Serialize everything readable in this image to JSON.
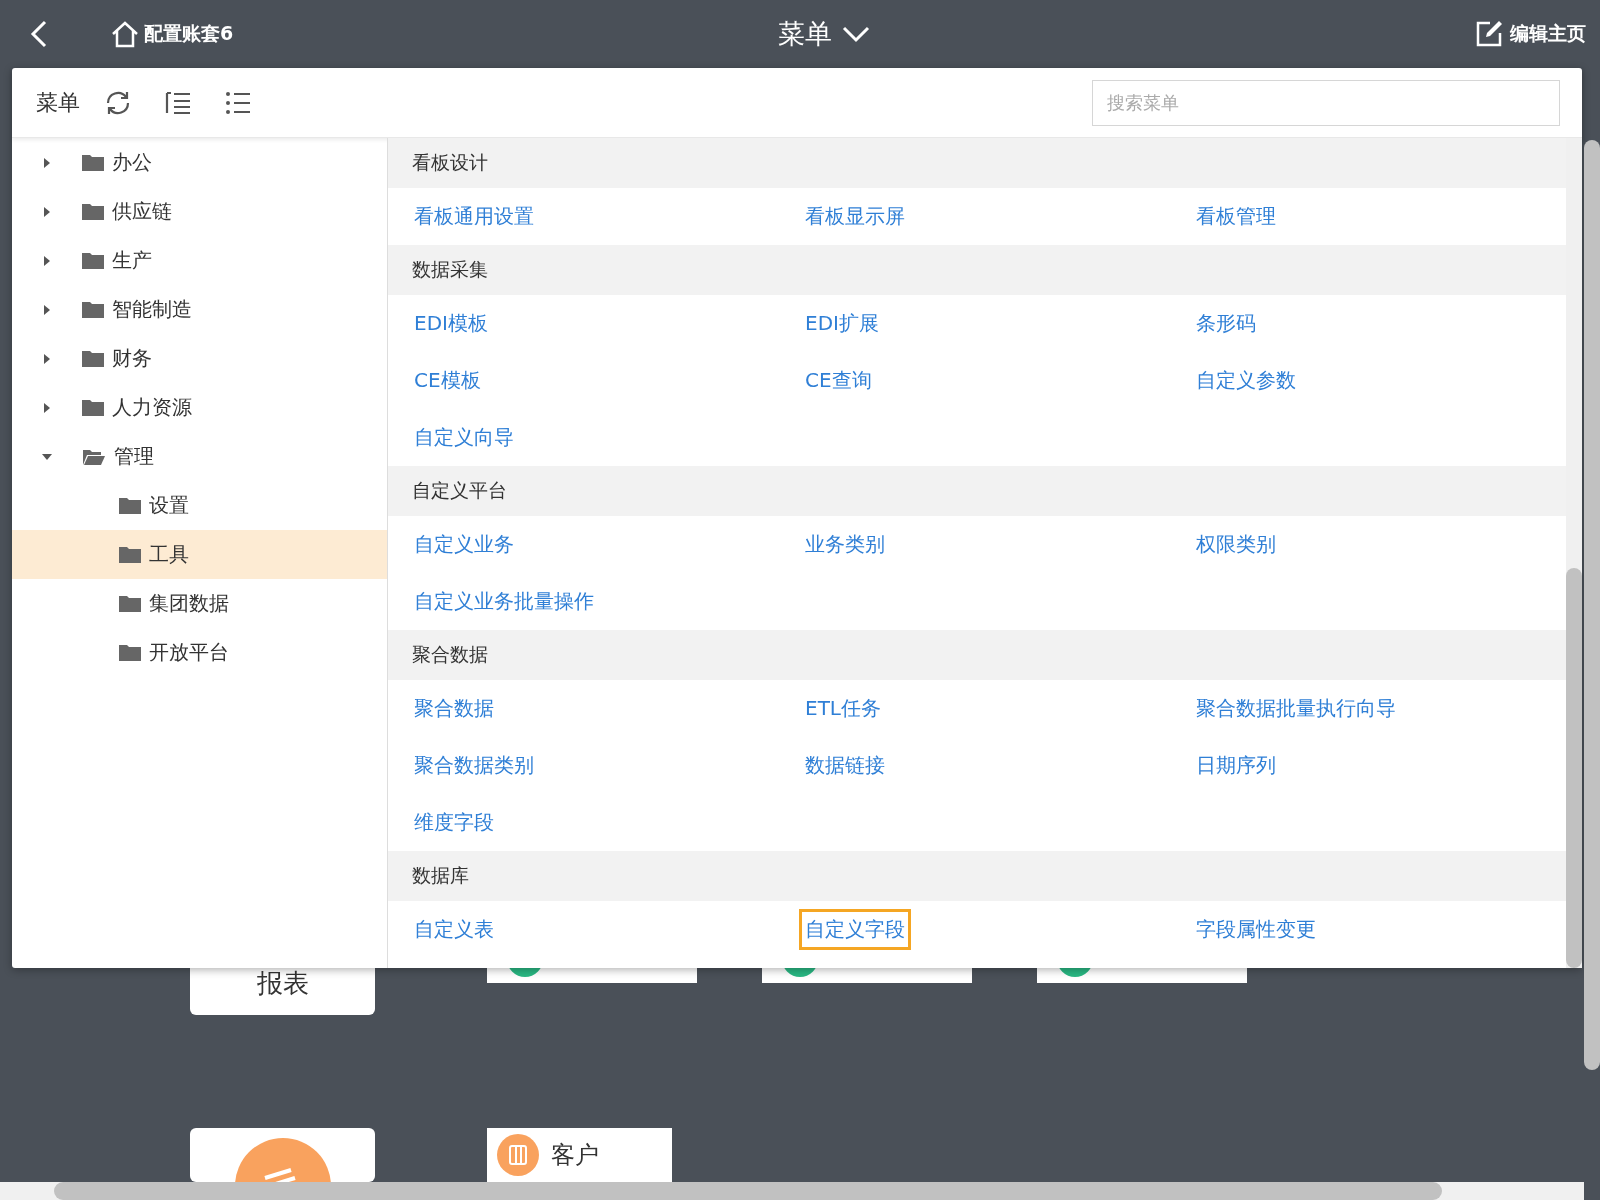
{
  "header": {
    "account": "配置账套6",
    "title": "菜单",
    "edit_label": "编辑主页"
  },
  "panel": {
    "title": "菜单",
    "search": {
      "placeholder": "搜索菜单"
    },
    "tree": [
      {
        "label": "办公",
        "expanded": false,
        "selected": false
      },
      {
        "label": "供应链",
        "expanded": false,
        "selected": false
      },
      {
        "label": "生产",
        "expanded": false,
        "selected": false
      },
      {
        "label": "智能制造",
        "expanded": false,
        "selected": false
      },
      {
        "label": "财务",
        "expanded": false,
        "selected": false
      },
      {
        "label": "人力资源",
        "expanded": false,
        "selected": false
      },
      {
        "label": "管理",
        "expanded": true,
        "selected": false,
        "children": [
          {
            "label": "设置",
            "selected": false
          },
          {
            "label": "工具",
            "selected": true
          },
          {
            "label": "集团数据",
            "selected": false
          },
          {
            "label": "开放平台",
            "selected": false
          }
        ]
      }
    ],
    "sections": [
      {
        "title": "看板设计",
        "links": [
          {
            "label": "看板通用设置",
            "selected": false
          },
          {
            "label": "看板显示屏",
            "selected": false
          },
          {
            "label": "看板管理",
            "selected": false
          }
        ]
      },
      {
        "title": "数据采集",
        "links": [
          {
            "label": "EDI模板",
            "selected": false
          },
          {
            "label": "EDI扩展",
            "selected": false
          },
          {
            "label": "条形码",
            "selected": false
          },
          {
            "label": "CE模板",
            "selected": false
          },
          {
            "label": "CE查询",
            "selected": false
          },
          {
            "label": "自定义参数",
            "selected": false
          },
          {
            "label": "自定义向导",
            "selected": false
          }
        ]
      },
      {
        "title": "自定义平台",
        "links": [
          {
            "label": "自定义业务",
            "selected": false
          },
          {
            "label": "业务类别",
            "selected": false
          },
          {
            "label": "权限类别",
            "selected": false
          },
          {
            "label": "自定义业务批量操作",
            "selected": false
          }
        ]
      },
      {
        "title": "聚合数据",
        "links": [
          {
            "label": "聚合数据",
            "selected": false
          },
          {
            "label": "ETL任务",
            "selected": false
          },
          {
            "label": "聚合数据批量执行向导",
            "selected": false
          },
          {
            "label": "聚合数据类别",
            "selected": false
          },
          {
            "label": "数据链接",
            "selected": false
          },
          {
            "label": "日期序列",
            "selected": false
          },
          {
            "label": "维度字段",
            "selected": false
          }
        ]
      },
      {
        "title": "数据库",
        "links": [
          {
            "label": "自定义表",
            "selected": false
          },
          {
            "label": "自定义字段",
            "selected": true
          },
          {
            "label": "字段属性变更",
            "selected": false
          }
        ]
      }
    ]
  },
  "background": {
    "row_1": [
      {
        "kind": "tile",
        "label": "报表"
      },
      {
        "kind": "covered"
      },
      {
        "kind": "covered"
      },
      {
        "kind": "covered"
      }
    ],
    "row_2": [
      {
        "kind": "picture-tile"
      },
      {
        "kind": "chip",
        "label": "客户"
      }
    ]
  }
}
